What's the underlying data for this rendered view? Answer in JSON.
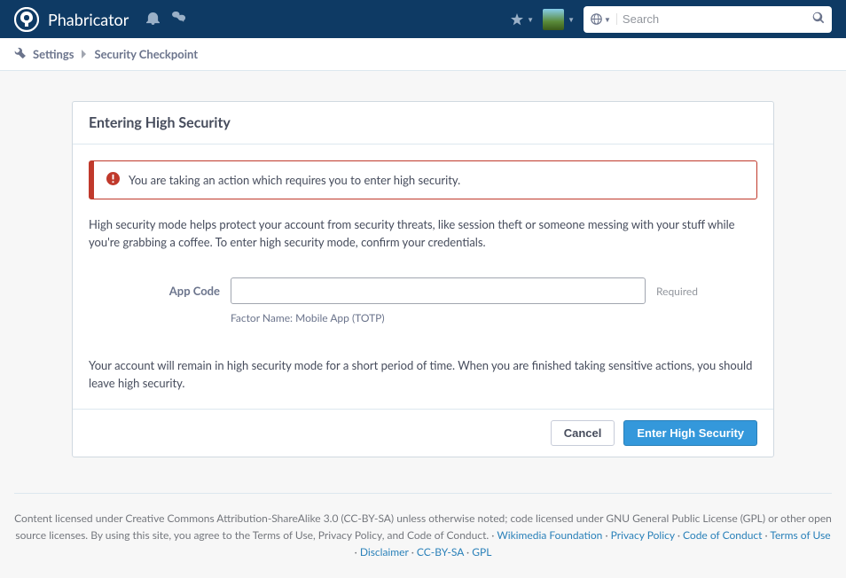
{
  "header": {
    "app_title": "Phabricator",
    "search_placeholder": "Search"
  },
  "breadcrumb": {
    "settings": "Settings",
    "security": "Security Checkpoint"
  },
  "card": {
    "title": "Entering High Security",
    "alert": "You are taking an action which requires you to enter high security.",
    "info": "High security mode helps protect your account from security threats, like session theft or someone messing with your stuff while you're grabbing a coffee. To enter high security mode, confirm your credentials.",
    "form": {
      "label": "App Code",
      "required": "Required",
      "factor_name": "Factor Name: Mobile App (TOTP)"
    },
    "footer_text": "Your account will remain in high security mode for a short period of time. When you are finished taking sensitive actions, you should leave high security.",
    "cancel": "Cancel",
    "submit": "Enter High Security"
  },
  "footer": {
    "license_text": "Content licensed under Creative Commons Attribution-ShareAlike 3.0 (CC-BY-SA) unless otherwise noted; code licensed under GNU General Public License (GPL) or other open source licenses. By using this site, you agree to the Terms of Use, Privacy Policy, and Code of Conduct.",
    "links": {
      "wikimedia": "Wikimedia Foundation",
      "privacy": "Privacy Policy",
      "conduct": "Code of Conduct",
      "terms": "Terms of Use",
      "disclaimer": "Disclaimer",
      "ccbysa": "CC-BY-SA",
      "gpl": "GPL"
    }
  }
}
